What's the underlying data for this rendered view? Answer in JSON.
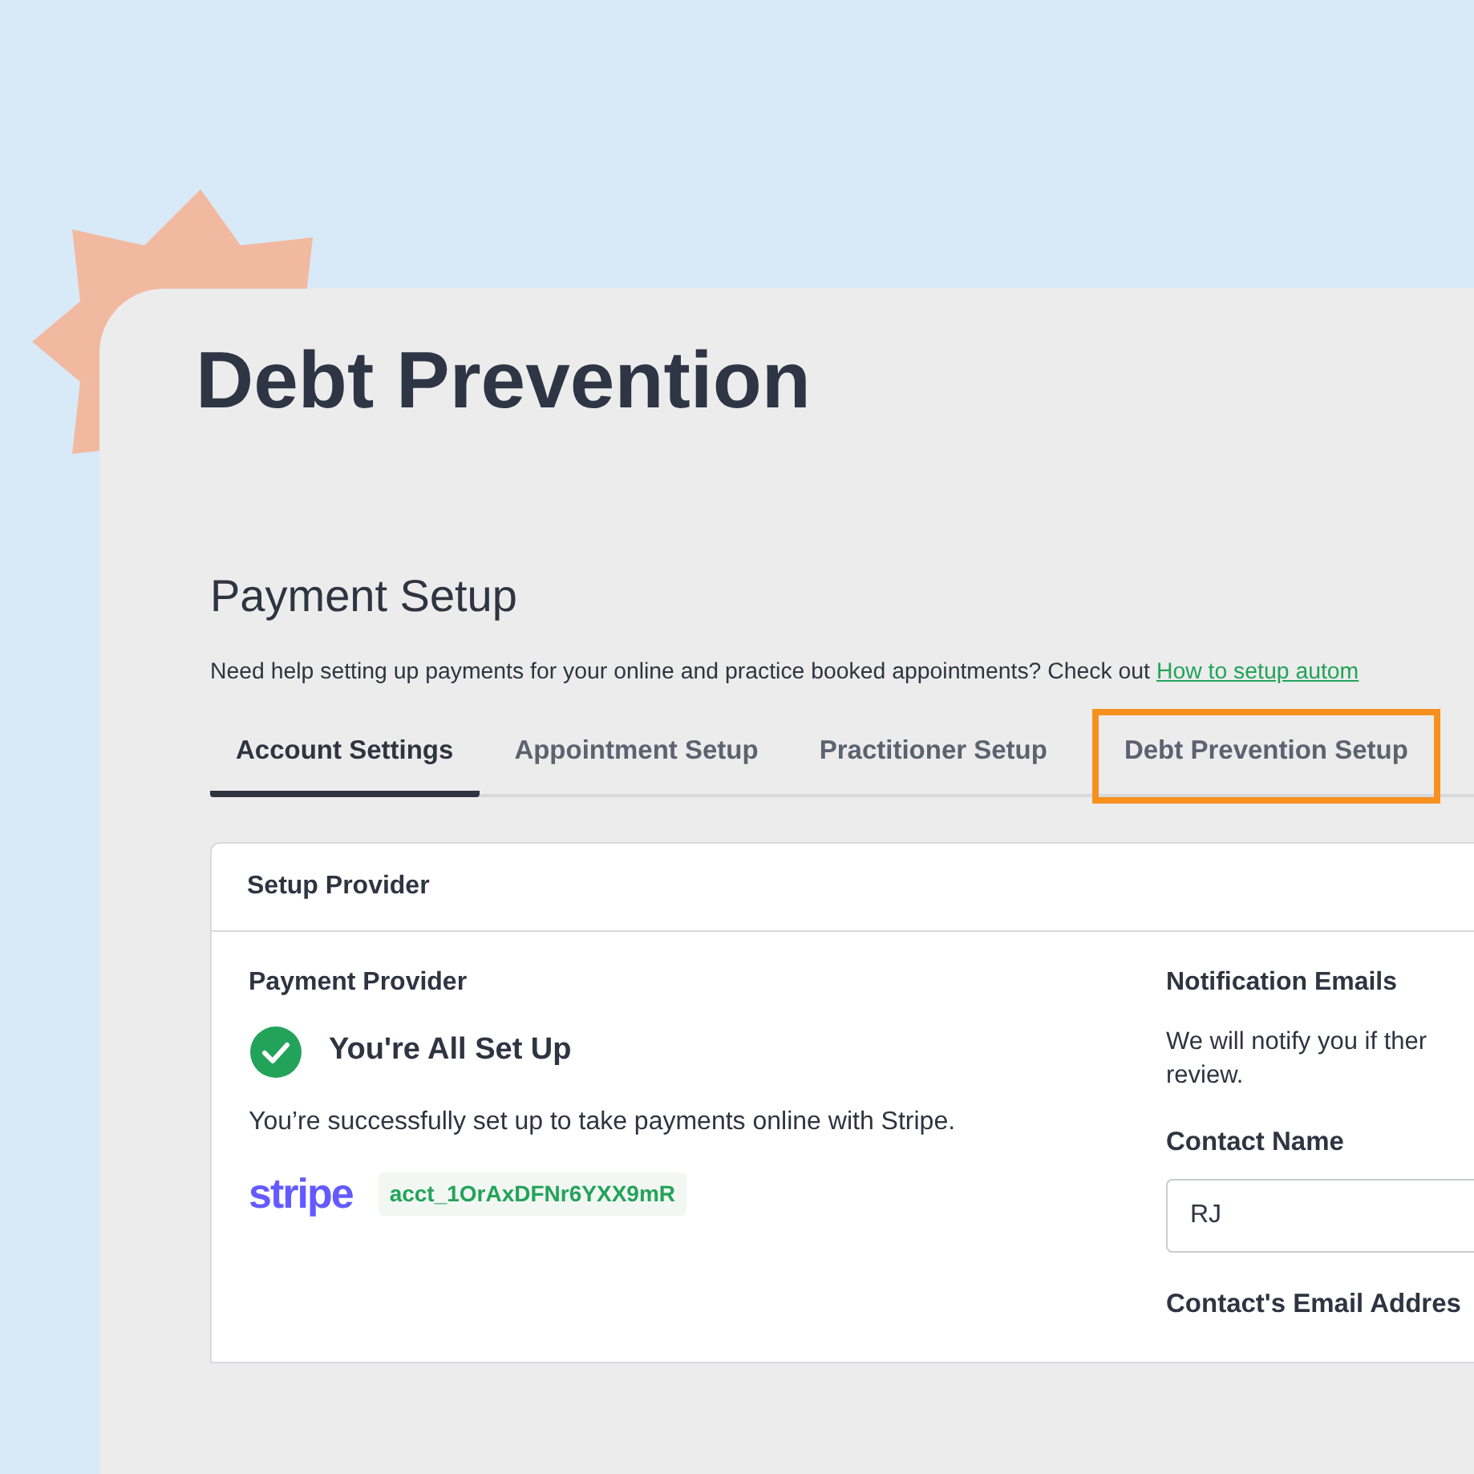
{
  "page_title": "Debt Prevention",
  "section": {
    "title": "Payment Setup",
    "help_text": "Need help setting up payments for your online and practice booked appointments? Check out ",
    "help_link": "How to setup autom"
  },
  "tabs": [
    {
      "label": "Account Settings",
      "selected": true,
      "highlighted": false
    },
    {
      "label": "Appointment Setup",
      "selected": false,
      "highlighted": false
    },
    {
      "label": "Practitioner Setup",
      "selected": false,
      "highlighted": false
    },
    {
      "label": "Debt Prevention Setup",
      "selected": false,
      "highlighted": true
    }
  ],
  "card": {
    "header": "Setup Provider",
    "provider": {
      "heading": "Payment Provider",
      "status": "You're All Set Up",
      "description": "You’re successfully set up to take payments online with Stripe.",
      "logo_text": "stripe",
      "account_id": "acct_1OrAxDFNr6YXX9mR"
    },
    "notifications": {
      "heading": "Notification Emails",
      "description": "We will notify you if ther",
      "description_line_2": "review.",
      "contact_name_label": "Contact Name",
      "contact_name_value": "RJ",
      "email_label": "Contact's Email Addres"
    }
  }
}
